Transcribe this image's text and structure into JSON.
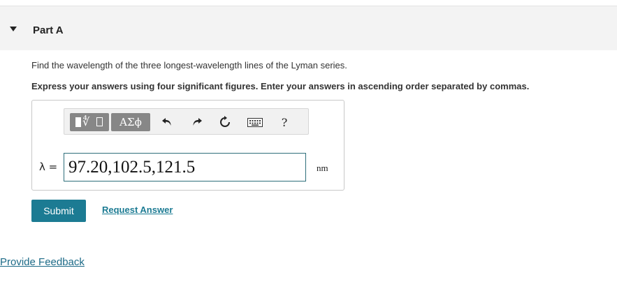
{
  "part": {
    "title": "Part A"
  },
  "question": {
    "text": "Find the wavelength of the three longest-wavelength lines of the Lyman series.",
    "instruction": "Express your answers using four significant figures. Enter your answers in ascending order separated by commas."
  },
  "toolbar": {
    "greek_label": "ΑΣϕ",
    "help_label": "?"
  },
  "answer": {
    "variable_label": "λ =",
    "value": "97.20,102.5,121.5",
    "unit": "nm"
  },
  "actions": {
    "submit_label": "Submit",
    "request_answer_label": "Request Answer"
  },
  "footer": {
    "feedback_label": "Provide Feedback"
  },
  "colors": {
    "accent": "#1c7b93",
    "input_border": "#2e6f7b",
    "toolbar_button": "#878787"
  }
}
